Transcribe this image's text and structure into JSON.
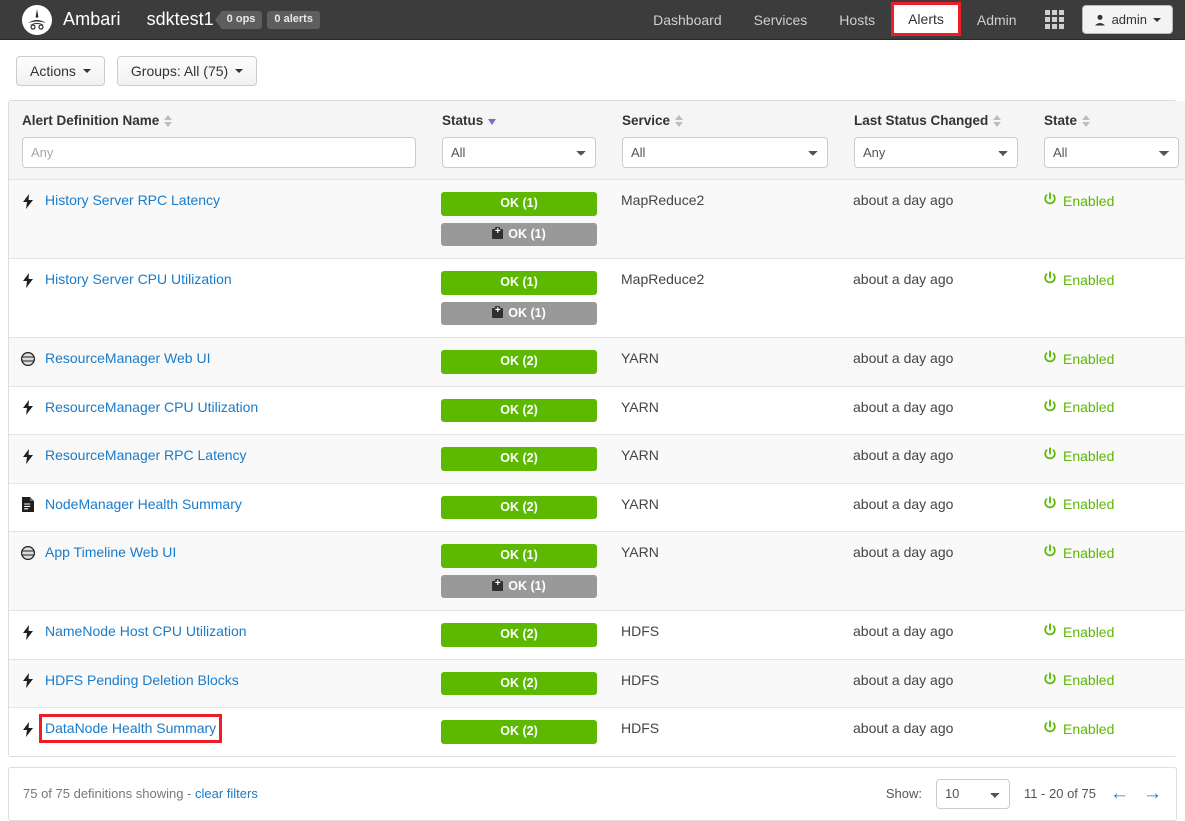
{
  "navbar": {
    "brand": "Ambari",
    "cluster": "sdktest1",
    "ops_chip": "0 ops",
    "alerts_chip": "0 alerts",
    "items": [
      {
        "label": "Dashboard",
        "active": false
      },
      {
        "label": "Services",
        "active": false
      },
      {
        "label": "Hosts",
        "active": false
      },
      {
        "label": "Alerts",
        "active": true
      },
      {
        "label": "Admin",
        "active": false
      }
    ],
    "grid_icon": "apps-grid-icon",
    "user": "admin",
    "highlight_color": "#ee1c25"
  },
  "toolbar": {
    "actions_label": "Actions",
    "groups_label": "Groups:  All (75)"
  },
  "table": {
    "columns": [
      {
        "title": "Alert Definition Name",
        "sort": "both",
        "filter_type": "input",
        "filter_value": "",
        "filter_placeholder": "Any"
      },
      {
        "title": "Status",
        "sort": "desc",
        "filter_type": "select",
        "filter_value": "All"
      },
      {
        "title": "Service",
        "sort": "both",
        "filter_type": "select",
        "filter_value": "All"
      },
      {
        "title": "Last Status Changed",
        "sort": "both",
        "filter_type": "select",
        "filter_value": "Any"
      },
      {
        "title": "State",
        "sort": "both",
        "filter_type": "select",
        "filter_value": "All"
      }
    ],
    "rows": [
      {
        "icon": "lightning-bolt-icon",
        "name": "History Server RPC Latency",
        "boxed": false,
        "badges": [
          {
            "label": "OK (1)",
            "kind": "ok"
          },
          {
            "label": "OK (1)",
            "kind": "maint"
          }
        ],
        "service": "MapReduce2",
        "last_changed": "about a day ago",
        "state": "Enabled"
      },
      {
        "icon": "lightning-bolt-icon",
        "name": "History Server CPU Utilization",
        "boxed": false,
        "badges": [
          {
            "label": "OK (1)",
            "kind": "ok"
          },
          {
            "label": "OK (1)",
            "kind": "maint"
          }
        ],
        "service": "MapReduce2",
        "last_changed": "about a day ago",
        "state": "Enabled"
      },
      {
        "icon": "globe-icon",
        "name": "ResourceManager Web UI",
        "boxed": false,
        "badges": [
          {
            "label": "OK (2)",
            "kind": "ok"
          }
        ],
        "service": "YARN",
        "last_changed": "about a day ago",
        "state": "Enabled"
      },
      {
        "icon": "lightning-bolt-icon",
        "name": "ResourceManager CPU Utilization",
        "boxed": false,
        "badges": [
          {
            "label": "OK (2)",
            "kind": "ok"
          }
        ],
        "service": "YARN",
        "last_changed": "about a day ago",
        "state": "Enabled"
      },
      {
        "icon": "lightning-bolt-icon",
        "name": "ResourceManager RPC Latency",
        "boxed": false,
        "badges": [
          {
            "label": "OK (2)",
            "kind": "ok"
          }
        ],
        "service": "YARN",
        "last_changed": "about a day ago",
        "state": "Enabled"
      },
      {
        "icon": "document-icon",
        "name": "NodeManager Health Summary",
        "boxed": false,
        "badges": [
          {
            "label": "OK (2)",
            "kind": "ok"
          }
        ],
        "service": "YARN",
        "last_changed": "about a day ago",
        "state": "Enabled"
      },
      {
        "icon": "globe-icon",
        "name": "App Timeline Web UI",
        "boxed": false,
        "badges": [
          {
            "label": "OK (1)",
            "kind": "ok"
          },
          {
            "label": "OK (1)",
            "kind": "maint"
          }
        ],
        "service": "YARN",
        "last_changed": "about a day ago",
        "state": "Enabled"
      },
      {
        "icon": "lightning-bolt-icon",
        "name": "NameNode Host CPU Utilization",
        "boxed": false,
        "badges": [
          {
            "label": "OK (2)",
            "kind": "ok"
          }
        ],
        "service": "HDFS",
        "last_changed": "about a day ago",
        "state": "Enabled"
      },
      {
        "icon": "lightning-bolt-icon",
        "name": "HDFS Pending Deletion Blocks",
        "boxed": false,
        "badges": [
          {
            "label": "OK (2)",
            "kind": "ok"
          }
        ],
        "service": "HDFS",
        "last_changed": "about a day ago",
        "state": "Enabled"
      },
      {
        "icon": "lightning-bolt-icon",
        "name": "DataNode Health Summary",
        "boxed": true,
        "badges": [
          {
            "label": "OK (2)",
            "kind": "ok"
          }
        ],
        "service": "HDFS",
        "last_changed": "about a day ago",
        "state": "Enabled"
      }
    ]
  },
  "footer": {
    "summary": "75 of 75 definitions showing - ",
    "clear_filters": "clear filters",
    "show_label": "Show:",
    "page_size": "10",
    "range": "11 - 20 of 75",
    "prev_icon": "arrow-left-icon",
    "next_icon": "arrow-right-icon"
  },
  "colors": {
    "ok_green": "#5db800",
    "maintenance_gray": "#999999",
    "link_blue": "#1a7bc9",
    "highlight_red": "#ee1c25",
    "navbar_dark": "#3c3c3c"
  }
}
